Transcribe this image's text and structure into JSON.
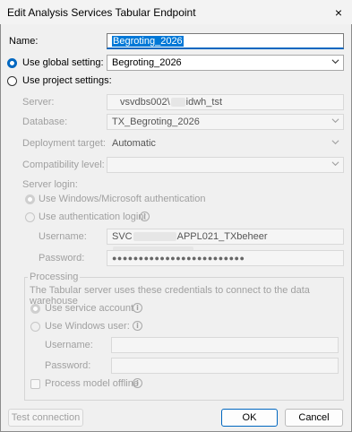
{
  "window": {
    "title": "Edit Analysis Services Tabular Endpoint"
  },
  "name": {
    "label": "Name:",
    "value": "Begroting_2026"
  },
  "global": {
    "label": "Use global setting:",
    "value": "Begroting_2026"
  },
  "project": {
    "label": "Use project settings:"
  },
  "server": {
    "label": "Server:",
    "value_prefix": "vsvdbs002\\",
    "value_suffix": "idwh_tst"
  },
  "database": {
    "label": "Database:",
    "value": "TX_Begroting_2026"
  },
  "deployment": {
    "label": "Deployment target:",
    "value": "Automatic"
  },
  "compat": {
    "label": "Compatibility level:",
    "value": ""
  },
  "login": {
    "heading": "Server login:",
    "windows_auth": "Use Windows/Microsoft authentication",
    "auth_login": "Use authentication login:",
    "username_label": "Username:",
    "username_prefix": "SVC",
    "username_mid": "APPL021_TXbeheer",
    "password_label": "Password:",
    "password_value": "●●●●●●●●●●●●●●●●●●●●●●●●●"
  },
  "processing": {
    "legend": "Processing",
    "description": "The Tabular server uses these credentials to connect to the data warehouse",
    "service_account": "Use service account",
    "windows_user": "Use Windows user:",
    "username_label": "Username:",
    "password_label": "Password:",
    "offline": "Process model offline"
  },
  "buttons": {
    "test": "Test connection",
    "ok": "OK",
    "cancel": "Cancel"
  },
  "icons": {
    "close": "×",
    "info": "i"
  }
}
